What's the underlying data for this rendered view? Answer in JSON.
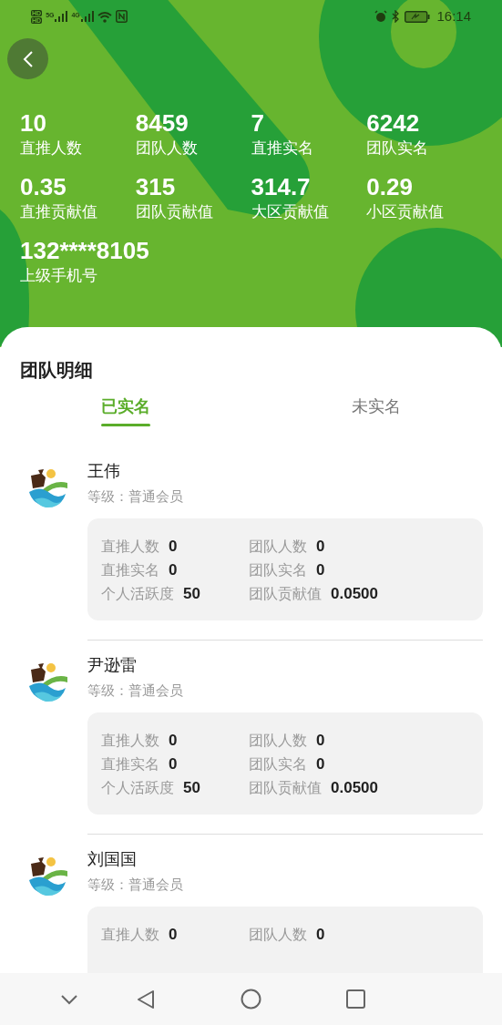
{
  "status_bar": {
    "sim_badges": [
      "HD",
      "HD"
    ],
    "networks": [
      "5G",
      "4G"
    ],
    "time": "16:14"
  },
  "stats": [
    {
      "value": "10",
      "label": "直推人数"
    },
    {
      "value": "8459",
      "label": "团队人数"
    },
    {
      "value": "7",
      "label": "直推实名"
    },
    {
      "value": "6242",
      "label": "团队实名"
    },
    {
      "value": "0.35",
      "label": "直推贡献值"
    },
    {
      "value": "315",
      "label": "团队贡献值"
    },
    {
      "value": "314.7",
      "label": "大区贡献值"
    },
    {
      "value": "0.29",
      "label": "小区贡献值"
    },
    {
      "value": "132****8105",
      "label": "上级手机号"
    }
  ],
  "panel": {
    "title": "团队明细",
    "tabs": [
      {
        "label": "已实名",
        "selected": true
      },
      {
        "label": "未实名",
        "selected": false
      }
    ]
  },
  "members": [
    {
      "name": "王伟",
      "level": "等级：普通会员",
      "stats": [
        {
          "label": "直推人数",
          "value": "0"
        },
        {
          "label": "团队人数",
          "value": "0"
        },
        {
          "label": "直推实名",
          "value": "0"
        },
        {
          "label": "团队实名",
          "value": "0"
        },
        {
          "label": "个人活跃度",
          "value": "50"
        },
        {
          "label": "团队贡献值",
          "value": "0.0500"
        }
      ]
    },
    {
      "name": "尹逊雷",
      "level": "等级：普通会员",
      "stats": [
        {
          "label": "直推人数",
          "value": "0"
        },
        {
          "label": "团队人数",
          "value": "0"
        },
        {
          "label": "直推实名",
          "value": "0"
        },
        {
          "label": "团队实名",
          "value": "0"
        },
        {
          "label": "个人活跃度",
          "value": "50"
        },
        {
          "label": "团队贡献值",
          "value": "0.0500"
        }
      ]
    },
    {
      "name": "刘国国",
      "level": "等级：普通会员",
      "stats": [
        {
          "label": "直推人数",
          "value": "0"
        },
        {
          "label": "团队人数",
          "value": "0"
        }
      ]
    }
  ]
}
